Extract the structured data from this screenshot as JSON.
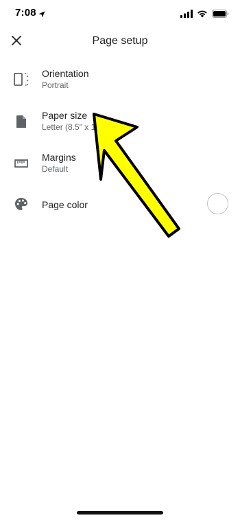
{
  "status_bar": {
    "time": "7:08",
    "icons": [
      "location-arrow-icon",
      "signal-icon",
      "wifi-icon",
      "battery-icon"
    ]
  },
  "header": {
    "title": "Page setup",
    "close_icon": "close-icon"
  },
  "settings": [
    {
      "title": "Orientation",
      "subtitle": "Portrait",
      "icon": "orientation-icon"
    },
    {
      "title": "Paper size",
      "subtitle": "Letter (8.5\" x 11\")",
      "icon": "paper-icon"
    },
    {
      "title": "Margins",
      "subtitle": "Default",
      "icon": "ruler-icon"
    },
    {
      "title": "Page color",
      "subtitle": "",
      "icon": "palette-icon",
      "swatch_color": "#ffffff"
    }
  ],
  "annotation": {
    "arrow_color": "#ffff00",
    "outline_color": "#000000"
  },
  "colors": {
    "text_primary": "#202124",
    "text_secondary": "#5f6368",
    "icon": "#5f6368"
  }
}
